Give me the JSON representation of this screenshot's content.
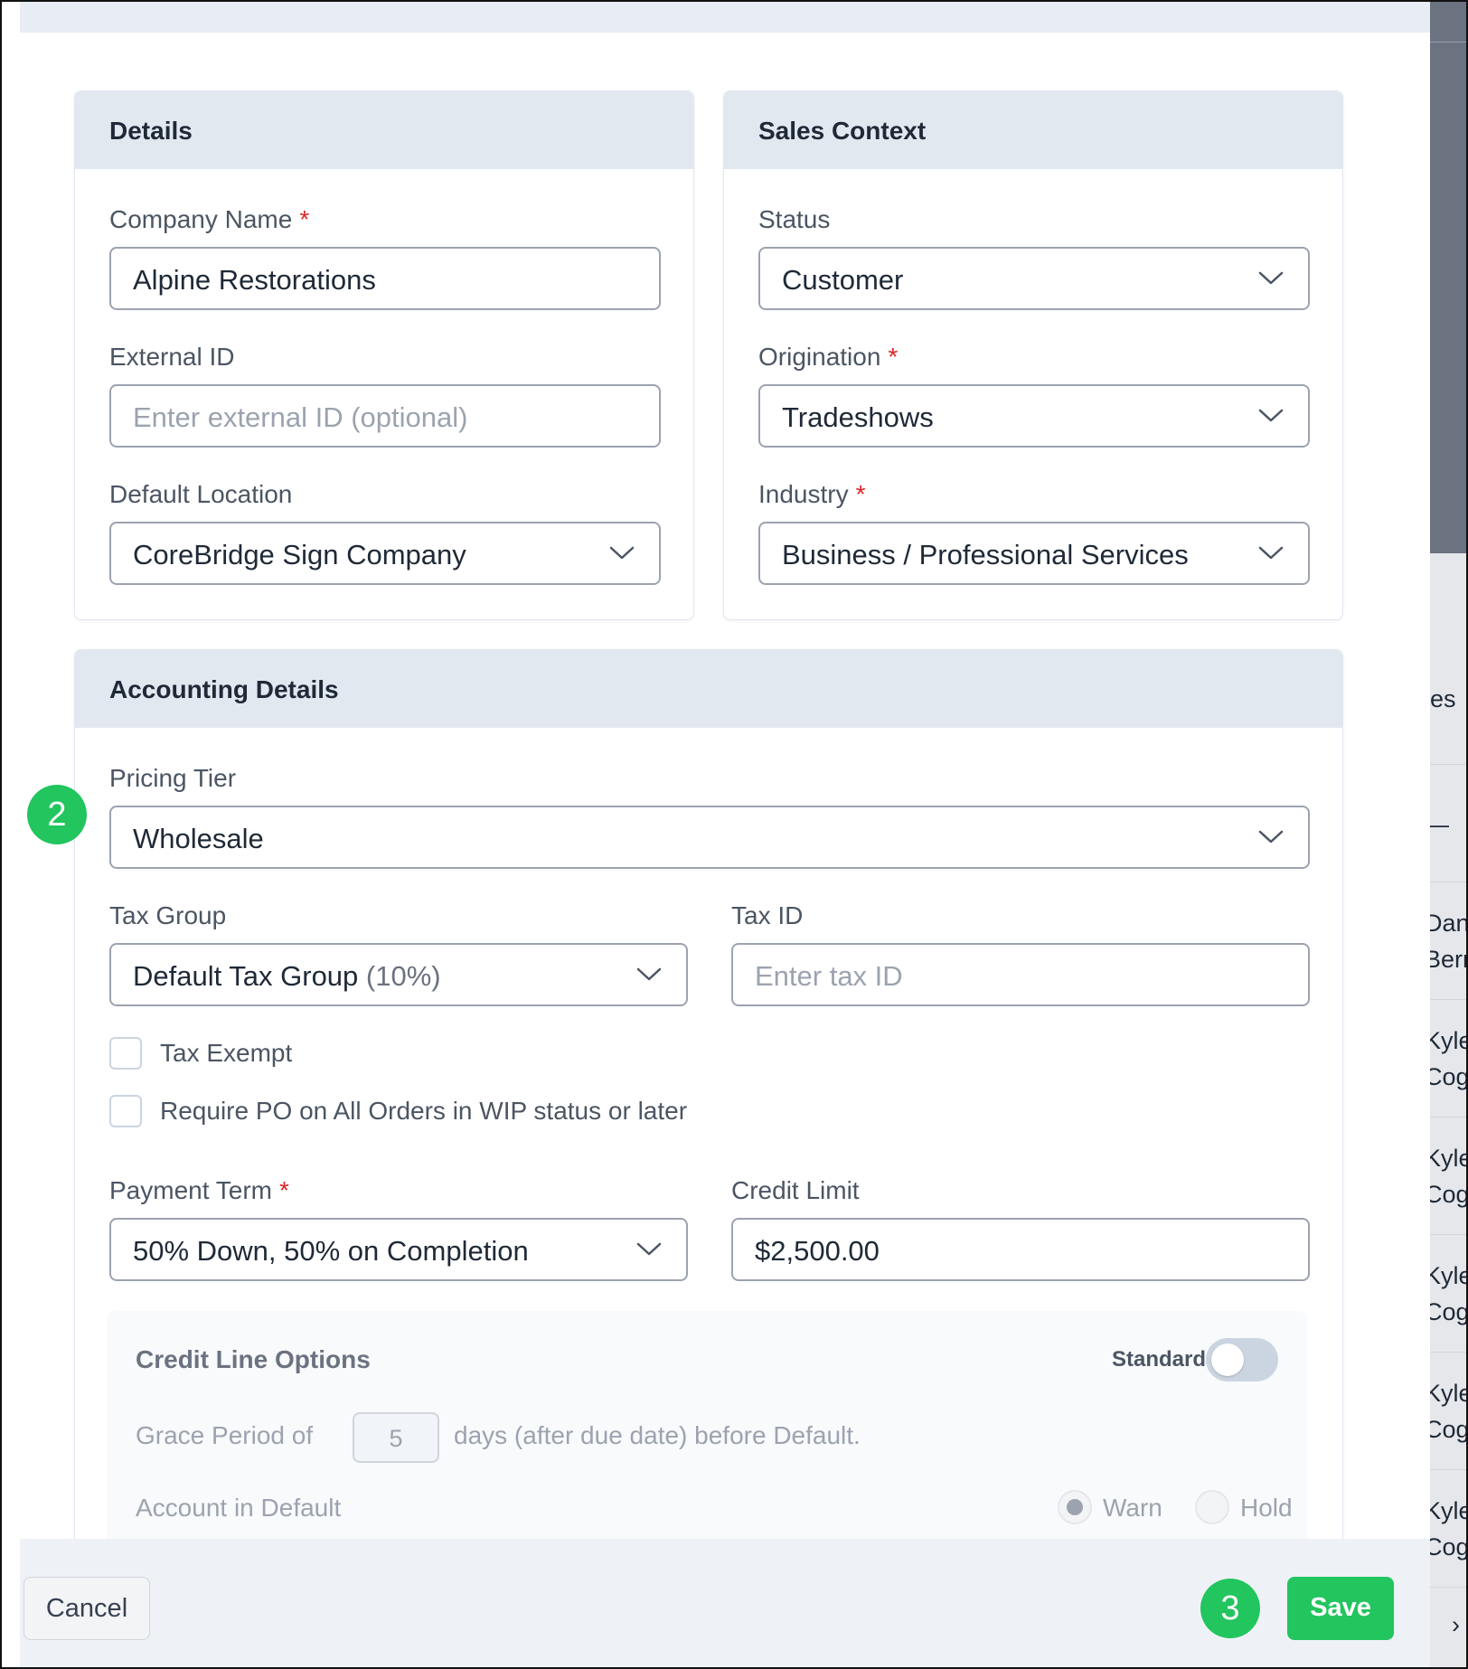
{
  "colors": {
    "accent": "#22c55e",
    "required": "#dc2626",
    "header_bg": "#e2e8f0"
  },
  "details": {
    "title": "Details",
    "company_name_label": "Company Name",
    "company_name_value": "Alpine Restorations",
    "external_id_label": "External ID",
    "external_id_placeholder": "Enter external ID (optional)",
    "default_location_label": "Default Location",
    "default_location_value": "CoreBridge Sign Company"
  },
  "sales_context": {
    "title": "Sales Context",
    "status_label": "Status",
    "status_value": "Customer",
    "origination_label": "Origination",
    "origination_value": "Tradeshows",
    "industry_label": "Industry",
    "industry_value": "Business / Professional Services"
  },
  "accounting": {
    "title": "Accounting Details",
    "pricing_tier_label": "Pricing Tier",
    "pricing_tier_value": "Wholesale",
    "tax_group_label": "Tax Group",
    "tax_group_value": "Default Tax Group",
    "tax_group_rate": "(10%)",
    "tax_id_label": "Tax ID",
    "tax_id_placeholder": "Enter tax ID",
    "tax_exempt_label": "Tax Exempt",
    "require_po_label": "Require PO on All Orders in WIP status or later",
    "payment_term_label": "Payment Term",
    "payment_term_value": "50% Down, 50% on Completion",
    "credit_limit_label": "Credit Limit",
    "credit_limit_value": "$2,500.00"
  },
  "credit_line": {
    "title": "Credit Line Options",
    "toggle_label": "Standard",
    "grace_prefix": "Grace Period of",
    "grace_value": "5",
    "grace_suffix": "days (after due date) before Default.",
    "default_label": "Account in Default",
    "option_warn": "Warn",
    "option_hold": "Hold"
  },
  "required_mark": "*",
  "footer": {
    "cancel_label": "Cancel",
    "save_label": "Save"
  },
  "steps": {
    "step2": "2",
    "step3": "3"
  },
  "background": {
    "text_1": "les",
    "text_2": "—",
    "rows": [
      "Dan",
      "Berr",
      "Kyle",
      "Cog",
      "Kyle",
      "Cog",
      "Kyle",
      "Cog",
      "Kyle",
      "Cog",
      "Kyle",
      "Cog"
    ],
    "chevron": "›"
  }
}
